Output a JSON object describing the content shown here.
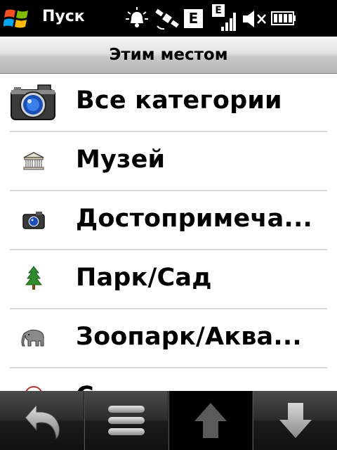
{
  "status_bar": {
    "start_label": "Пуск",
    "icons": [
      "windows-logo",
      "alarm-icon",
      "satellite-icon",
      "edge-e-icon",
      "signal-edge-icon",
      "speaker-muted-icon",
      "battery-icon"
    ],
    "edge_indicator": "E",
    "signal_indicator": "E"
  },
  "title_bar": {
    "title": "Этим местом"
  },
  "list": {
    "items": [
      {
        "label": "Все категории",
        "icon": "camera-large-icon"
      },
      {
        "label": "Музей",
        "icon": "museum-icon"
      },
      {
        "label": "Достопримеча...",
        "icon": "camera-small-icon"
      },
      {
        "label": "Парк/Сад",
        "icon": "tree-icon"
      },
      {
        "label": "Зоопарк/Аква...",
        "icon": "elephant-icon"
      },
      {
        "label": "С",
        "icon": "compass-icon"
      }
    ]
  },
  "toolbar": {
    "buttons": [
      "back-icon",
      "menu-icon",
      "up-arrow-icon",
      "down-arrow-icon"
    ],
    "active_index": 2
  },
  "colors": {
    "status_bg": "#000000",
    "list_bg": "#ffffff",
    "divider": "#d8d8d8",
    "toolbar_bg": "#1b1b1b"
  }
}
